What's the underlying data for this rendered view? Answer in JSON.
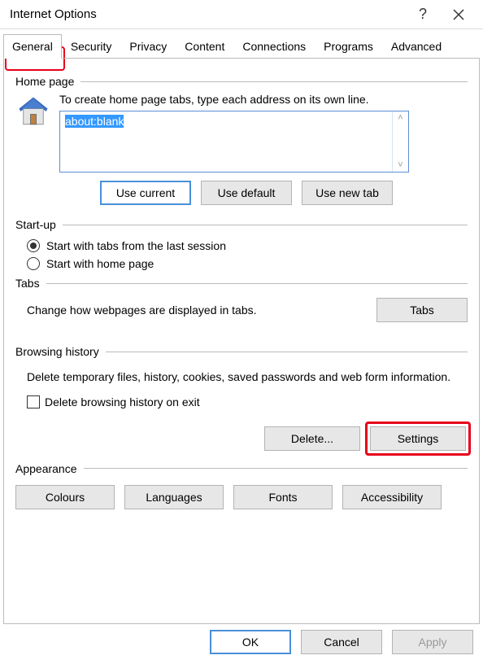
{
  "window": {
    "title": "Internet Options"
  },
  "tabs": [
    "General",
    "Security",
    "Privacy",
    "Content",
    "Connections",
    "Programs",
    "Advanced"
  ],
  "activeTab": 0,
  "homepage": {
    "label": "Home page",
    "instruction": "To create home page tabs, type each address on its own line.",
    "value": "about:blank",
    "buttons": {
      "useCurrent": "Use current",
      "useDefault": "Use default",
      "useNewTab": "Use new tab"
    }
  },
  "startup": {
    "label": "Start-up",
    "option1": "Start with tabs from the last session",
    "option2": "Start with home page",
    "selected": 0
  },
  "tabsSection": {
    "label": "Tabs",
    "desc": "Change how webpages are displayed in tabs.",
    "button": "Tabs"
  },
  "browsing": {
    "label": "Browsing history",
    "desc": "Delete temporary files, history, cookies, saved passwords and web form information.",
    "checkbox": "Delete browsing history on exit",
    "deleteBtn": "Delete...",
    "settingsBtn": "Settings"
  },
  "appearance": {
    "label": "Appearance",
    "colours": "Colours",
    "languages": "Languages",
    "fonts": "Fonts",
    "accessibility": "Accessibility"
  },
  "footer": {
    "ok": "OK",
    "cancel": "Cancel",
    "apply": "Apply"
  }
}
